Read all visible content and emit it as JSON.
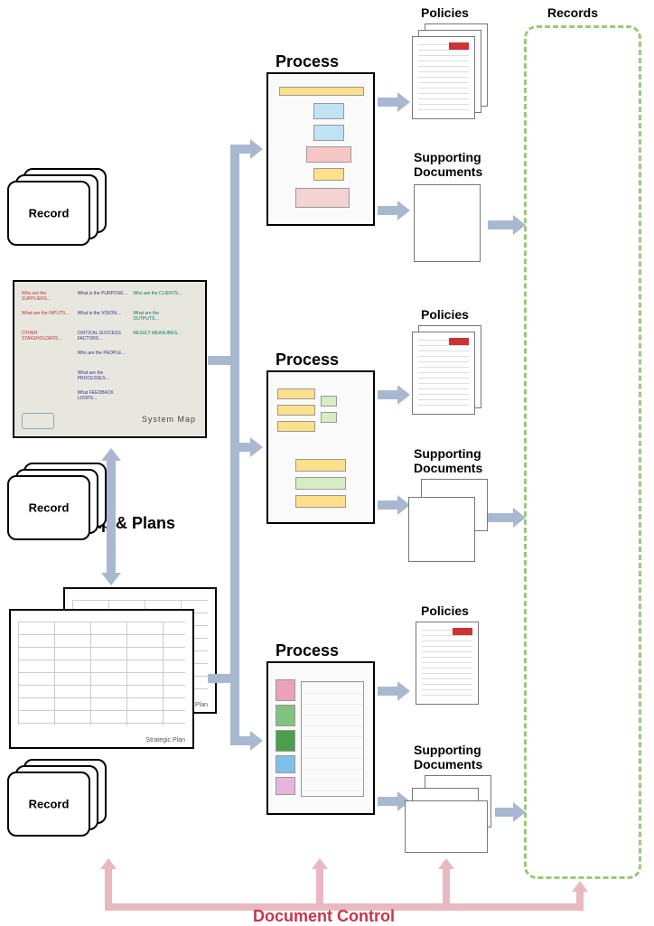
{
  "headings": {
    "system_map_plans": "System Map & Plans",
    "process": "Process",
    "policies": "Policies",
    "supporting_docs": "Supporting\nDocuments",
    "records": "Records",
    "record": "Record",
    "document_control": "Document Control"
  },
  "thumbnails": {
    "system_map_title": "System Map",
    "implementation_plan": "Implementation Plan",
    "strategic_plan": "Strategic Plan"
  }
}
